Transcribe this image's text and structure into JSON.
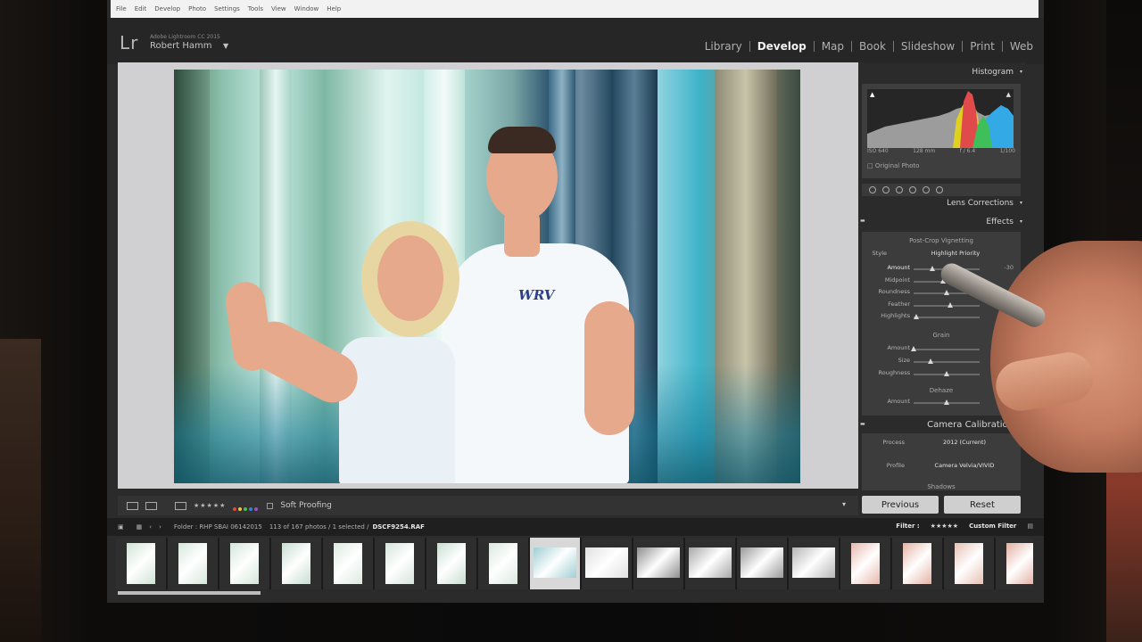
{
  "menubar": [
    "File",
    "Edit",
    "Develop",
    "Photo",
    "Settings",
    "Tools",
    "View",
    "Window",
    "Help"
  ],
  "identity": {
    "logo": "Lr",
    "app_name": "Adobe Lightroom CC 2015",
    "user_name": "Robert Hamm",
    "user_caret": "▼"
  },
  "modules": [
    "Library",
    "Develop",
    "Map",
    "Book",
    "Slideshow",
    "Print",
    "Web"
  ],
  "active_module": "Develop",
  "photo": {
    "shirt_logo": "WRV"
  },
  "toolbar": {
    "stars": "★★★★★",
    "soft_proofing": "Soft Proofing",
    "colors": [
      "#e24b3b",
      "#f0c63a",
      "#4bbf4b",
      "#3b7fe0",
      "#9a52c8"
    ]
  },
  "right_panel": {
    "histogram_title": "Histogram",
    "histogram_info": [
      "ISO 640",
      "128 mm",
      "f / 6.4",
      "1/100"
    ],
    "original_photo": "Original Photo",
    "lens_corrections": "Lens Corrections",
    "effects": "Effects",
    "vignetting_title": "Post-Crop Vignetting",
    "style_label": "Style",
    "style_value": "Highlight Priority",
    "vignette_sliders": [
      {
        "label": "Amount",
        "value": "-30",
        "pos": 0.28
      },
      {
        "label": "Midpoint",
        "value": "",
        "pos": 0.45
      },
      {
        "label": "Roundness",
        "value": "",
        "pos": 0.5
      },
      {
        "label": "Feather",
        "value": "",
        "pos": 0.55
      },
      {
        "label": "Highlights",
        "value": "",
        "pos": 0.04
      }
    ],
    "grain_title": "Grain",
    "grain_sliders": [
      {
        "label": "Amount",
        "value": "0",
        "pos": 0.0
      },
      {
        "label": "Size",
        "value": "",
        "pos": 0.25
      },
      {
        "label": "Roughness",
        "value": "",
        "pos": 0.5
      }
    ],
    "dehaze_title": "Dehaze",
    "dehaze_slider": {
      "label": "Amount",
      "value": "",
      "pos": 0.5
    },
    "camera_calibration": "Camera Calibration",
    "process_label": "Process",
    "process_value": "2012 (Current)",
    "profile_label": "Profile",
    "profile_value": "Camera Velvia/VIVID",
    "shadows_label": "Shadows",
    "previous_button": "Previous",
    "reset_button": "Reset"
  },
  "filmbar": {
    "folder_label": "Folder : RHP SBAI 06142015",
    "count": "113 of 167 photos / 1 selected /",
    "filename": "DSCF9254.RAF",
    "filter_label": "Filter :",
    "custom_filter": "Custom Filter"
  },
  "filmstrip": {
    "thumbs": [
      {
        "kind": "portrait",
        "color": "#cfe3d6"
      },
      {
        "kind": "portrait",
        "color": "#d7e8dd"
      },
      {
        "kind": "portrait",
        "color": "#d3e6d9"
      },
      {
        "kind": "portrait",
        "color": "#c6ddd1"
      },
      {
        "kind": "portrait",
        "color": "#dde9e1"
      },
      {
        "kind": "portrait",
        "color": "#d6e5dc"
      },
      {
        "kind": "portrait",
        "color": "#c9dfd3"
      },
      {
        "kind": "portrait",
        "color": "#dbe8df"
      },
      {
        "kind": "landscape",
        "color": "#9fcfd4",
        "selected": true
      },
      {
        "kind": "landscape",
        "color": "#e0e0e0"
      },
      {
        "kind": "landscape",
        "color": "#8e8e8e"
      },
      {
        "kind": "landscape",
        "color": "#a8a8a8"
      },
      {
        "kind": "landscape",
        "color": "#9a9a9a"
      },
      {
        "kind": "landscape",
        "color": "#b5b5b5"
      },
      {
        "kind": "portrait",
        "color": "#e7b9ae"
      },
      {
        "kind": "portrait",
        "color": "#e5b4a5"
      },
      {
        "kind": "portrait",
        "color": "#e8c1b6"
      },
      {
        "kind": "portrait",
        "color": "#e2b0a2"
      }
    ]
  }
}
